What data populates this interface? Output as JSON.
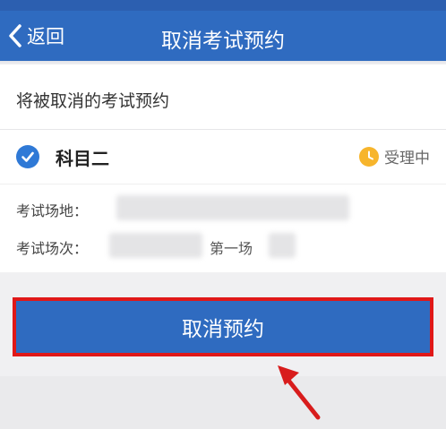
{
  "header": {
    "back_label": "返回",
    "title": "取消考试预约",
    "color": "#2f6bc0"
  },
  "card": {
    "section_title": "将被取消的考试预约",
    "subject": {
      "name": "科目二",
      "status": "受理中",
      "selected": true,
      "status_icon": "clock-icon"
    },
    "place_label": "考试场地：",
    "session_label": "考试场次：",
    "session_value": "第一场"
  },
  "actions": {
    "cancel_label": "取消预约",
    "highlight_color": "#e01818"
  }
}
